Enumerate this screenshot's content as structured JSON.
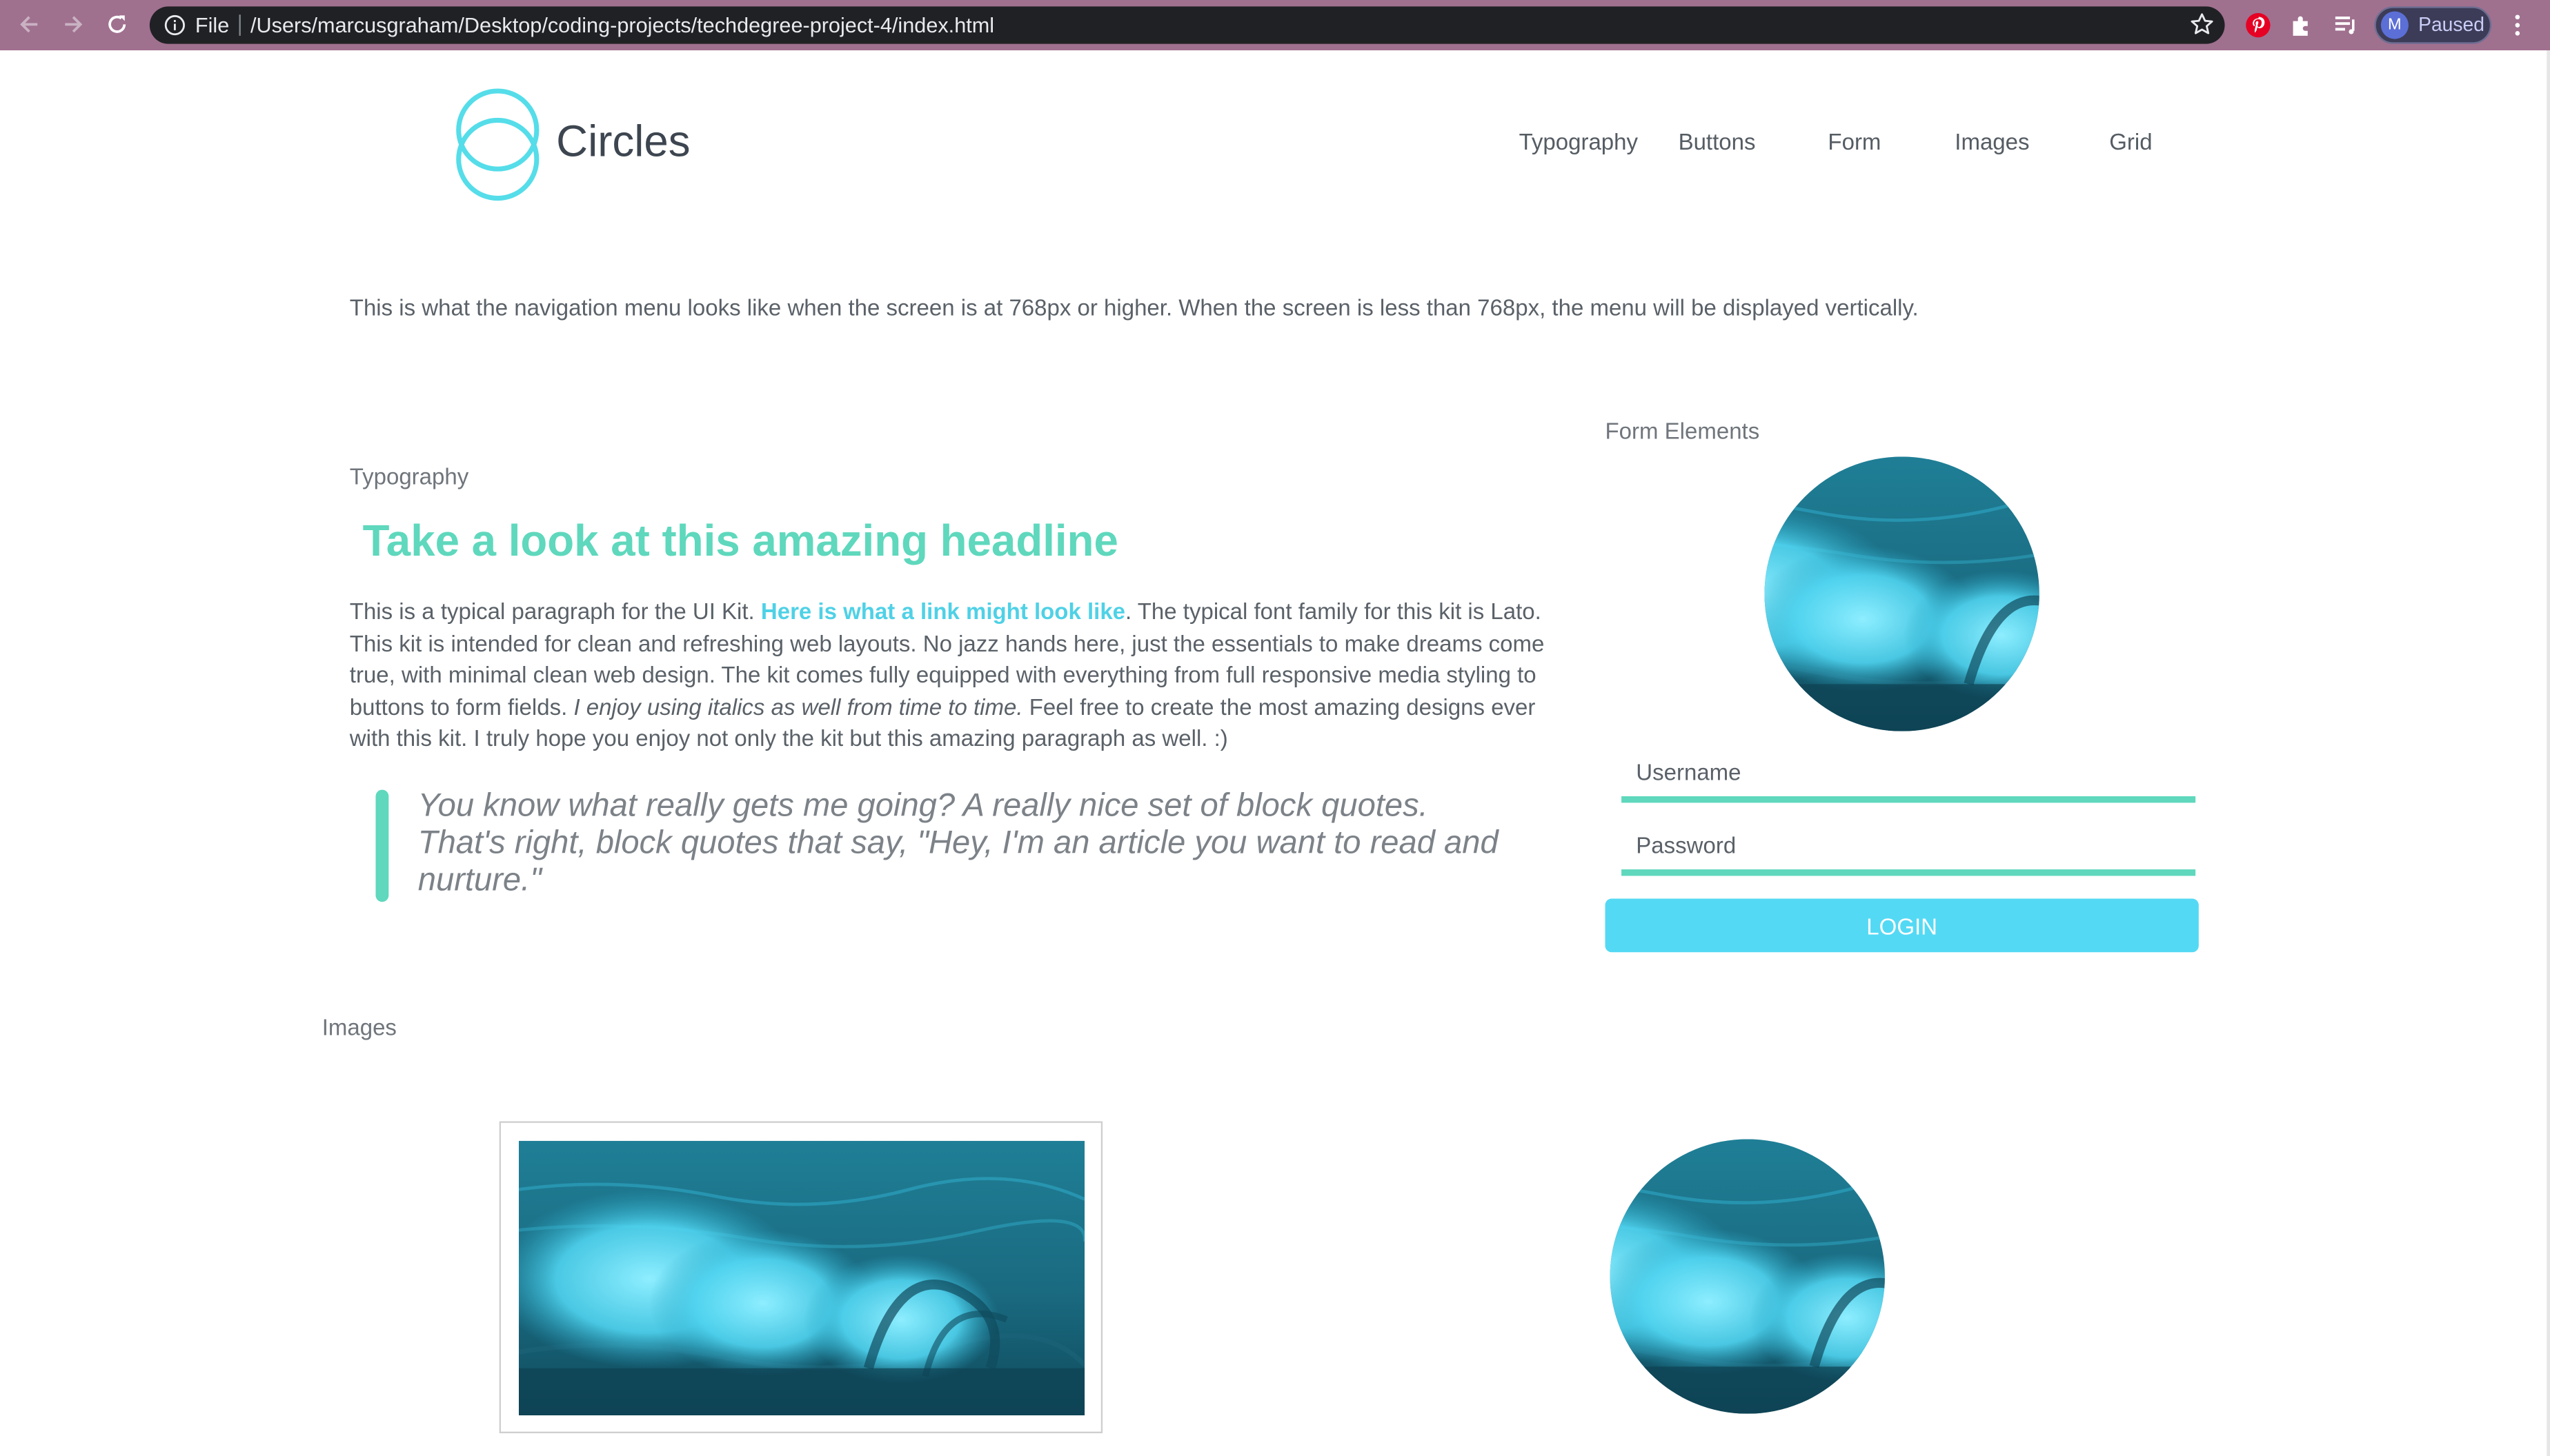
{
  "browser": {
    "scheme_label": "File",
    "url": "/Users/marcusgraham/Desktop/coding-projects/techdegree-project-4/index.html",
    "profile_initial": "M",
    "profile_status": "Paused"
  },
  "site": {
    "logo_text": "Circles",
    "nav": [
      "Typography",
      "Buttons",
      "Form",
      "Images",
      "Grid"
    ],
    "note": "This is what the navigation menu looks like when the screen is at 768px or higher. When the screen is less than 768px, the menu will be displayed vertically."
  },
  "typography": {
    "label": "Typography",
    "headline": "Take a look at this amazing headline",
    "para_start": "This is a typical paragraph for the UI Kit. ",
    "link_text": "Here is what a link might look like",
    "para_mid": ". The typical font family for this kit is Lato. This kit is intended for clean and refreshing web layouts. No jazz hands here, just the essentials to make dreams come true, with minimal clean web design. The kit comes fully equipped with everything from full responsive media styling to buttons to form fields. ",
    "italic_text": "I enjoy using italics as well from time to time.",
    "para_end": " Feel free to create the most amazing designs ever with this kit. I truly hope you enjoy not only the kit but this amazing paragraph as well. :)",
    "quote": "You know what really gets me going? A really nice set of block quotes. That's right, block quotes that say, \"Hey, I'm an article you want to read and nurture.\""
  },
  "form": {
    "label": "Form Elements",
    "username_placeholder": "Username",
    "password_placeholder": "Password",
    "login_label": "LOGIN"
  },
  "images": {
    "label": "Images"
  },
  "colors": {
    "accent_green": "#5fd8bd",
    "accent_cyan": "#54d9f4",
    "chrome": "#a0708f"
  }
}
